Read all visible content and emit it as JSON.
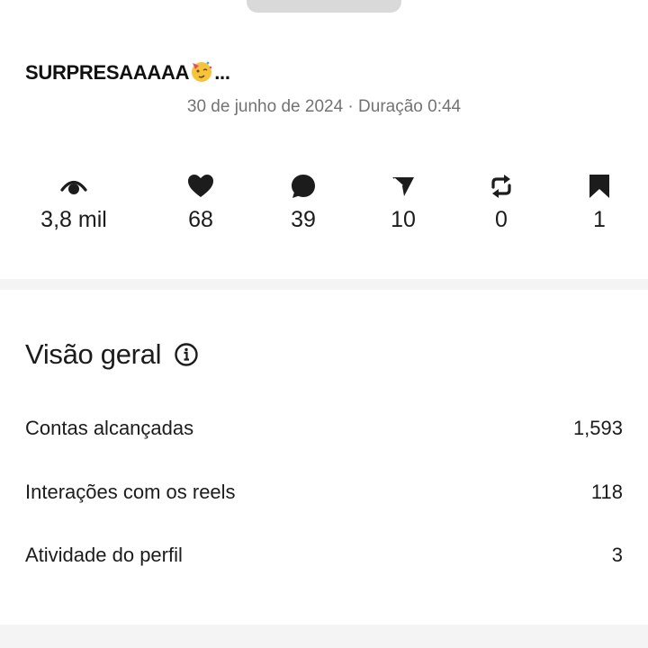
{
  "post": {
    "caption": "SURPRESAAAAA",
    "caption_emoji": "partying-face-emoji",
    "caption_ellipsis": "...",
    "meta": "30 de junho de 2024 · Duração 0:44"
  },
  "stats": [
    {
      "icon": "eye-icon",
      "value": "3,8 mil"
    },
    {
      "icon": "heart-icon",
      "value": "68"
    },
    {
      "icon": "comment-icon",
      "value": "39"
    },
    {
      "icon": "send-icon",
      "value": "10"
    },
    {
      "icon": "repost-icon",
      "value": "0"
    },
    {
      "icon": "bookmark-icon",
      "value": "1"
    }
  ],
  "overview": {
    "title": "Visão geral",
    "rows": [
      {
        "label": "Contas alcançadas",
        "value": "1,593"
      },
      {
        "label": "Interações com os reels",
        "value": "118"
      },
      {
        "label": "Atividade do perfil",
        "value": "3"
      }
    ]
  },
  "colors": {
    "text": "#1c1c1c",
    "muted": "#737373",
    "divider": "#f4f4f4"
  }
}
